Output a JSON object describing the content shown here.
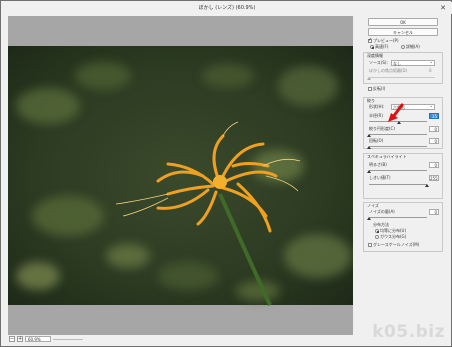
{
  "window": {
    "title": "ぼかし (レンズ) (60.9%)"
  },
  "status": {
    "zoom_out": "−",
    "zoom_in": "+",
    "zoom_value": "60.9%"
  },
  "panel": {
    "ok_label": "OK",
    "cancel_label": "キャンセル",
    "preview_label": "プレビュー(P)",
    "faster_label": "高速(F)",
    "accurate_label": "詳細(A)",
    "depth_map_title": "深度情報",
    "source_label": "ソース(S):",
    "source_value": "なし",
    "blur_focal_label": "ぼかしの焦点距離(D)",
    "blur_focal_value": "0",
    "invert_label": "反転(I)",
    "iris_title": "絞り",
    "shape_label": "形状(H):",
    "shape_value": "六角形",
    "radius_label": "半径(R)",
    "radius_value": "15",
    "curvature_label": "絞り円形度(C)",
    "curvature_value": "0",
    "rotation_label": "回転(O)",
    "rotation_value": "0",
    "specular_title": "スペキュラハイライト",
    "brightness_label": "明るさ(B)",
    "brightness_value": "0",
    "threshold_label": "しきい値(T)",
    "threshold_value": "255",
    "noise_title": "ノイズ",
    "noise_amount_label": "ノイズの量(A)",
    "noise_amount_value": "0",
    "distribution_label": "分布方法",
    "uniform_label": "均等に分布(U)",
    "gaussian_label": "ガウス分布(G)",
    "mono_label": "グレースケールノイズ(M)"
  },
  "watermark": "k05.biz",
  "colors": {
    "accent": "#3a8de0",
    "arrow": "#e01010",
    "flower": "#f0a020"
  }
}
